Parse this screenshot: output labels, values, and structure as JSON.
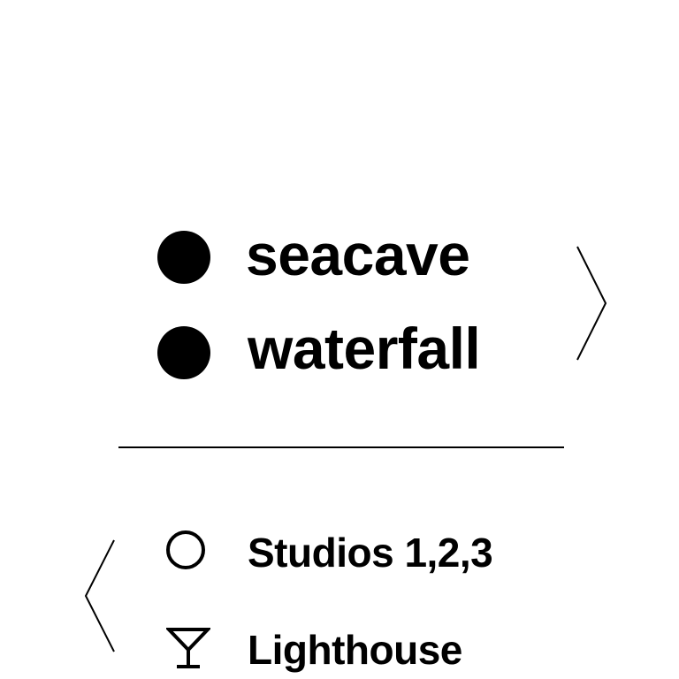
{
  "menu": {
    "primary_items": [
      {
        "label": "seacave",
        "icon": "filled-circle-icon"
      },
      {
        "label": "waterfall",
        "icon": "filled-circle-icon"
      }
    ],
    "secondary_items": [
      {
        "label": "Studios 1,2,3",
        "icon": "empty-circle-icon"
      },
      {
        "label": "Lighthouse",
        "icon": "cocktail-glass-icon"
      }
    ],
    "next_icon": "chevron-right-icon",
    "previous_icon": "chevron-left-icon"
  },
  "colors": {
    "foreground": "#000000",
    "background": "#ffffff"
  }
}
